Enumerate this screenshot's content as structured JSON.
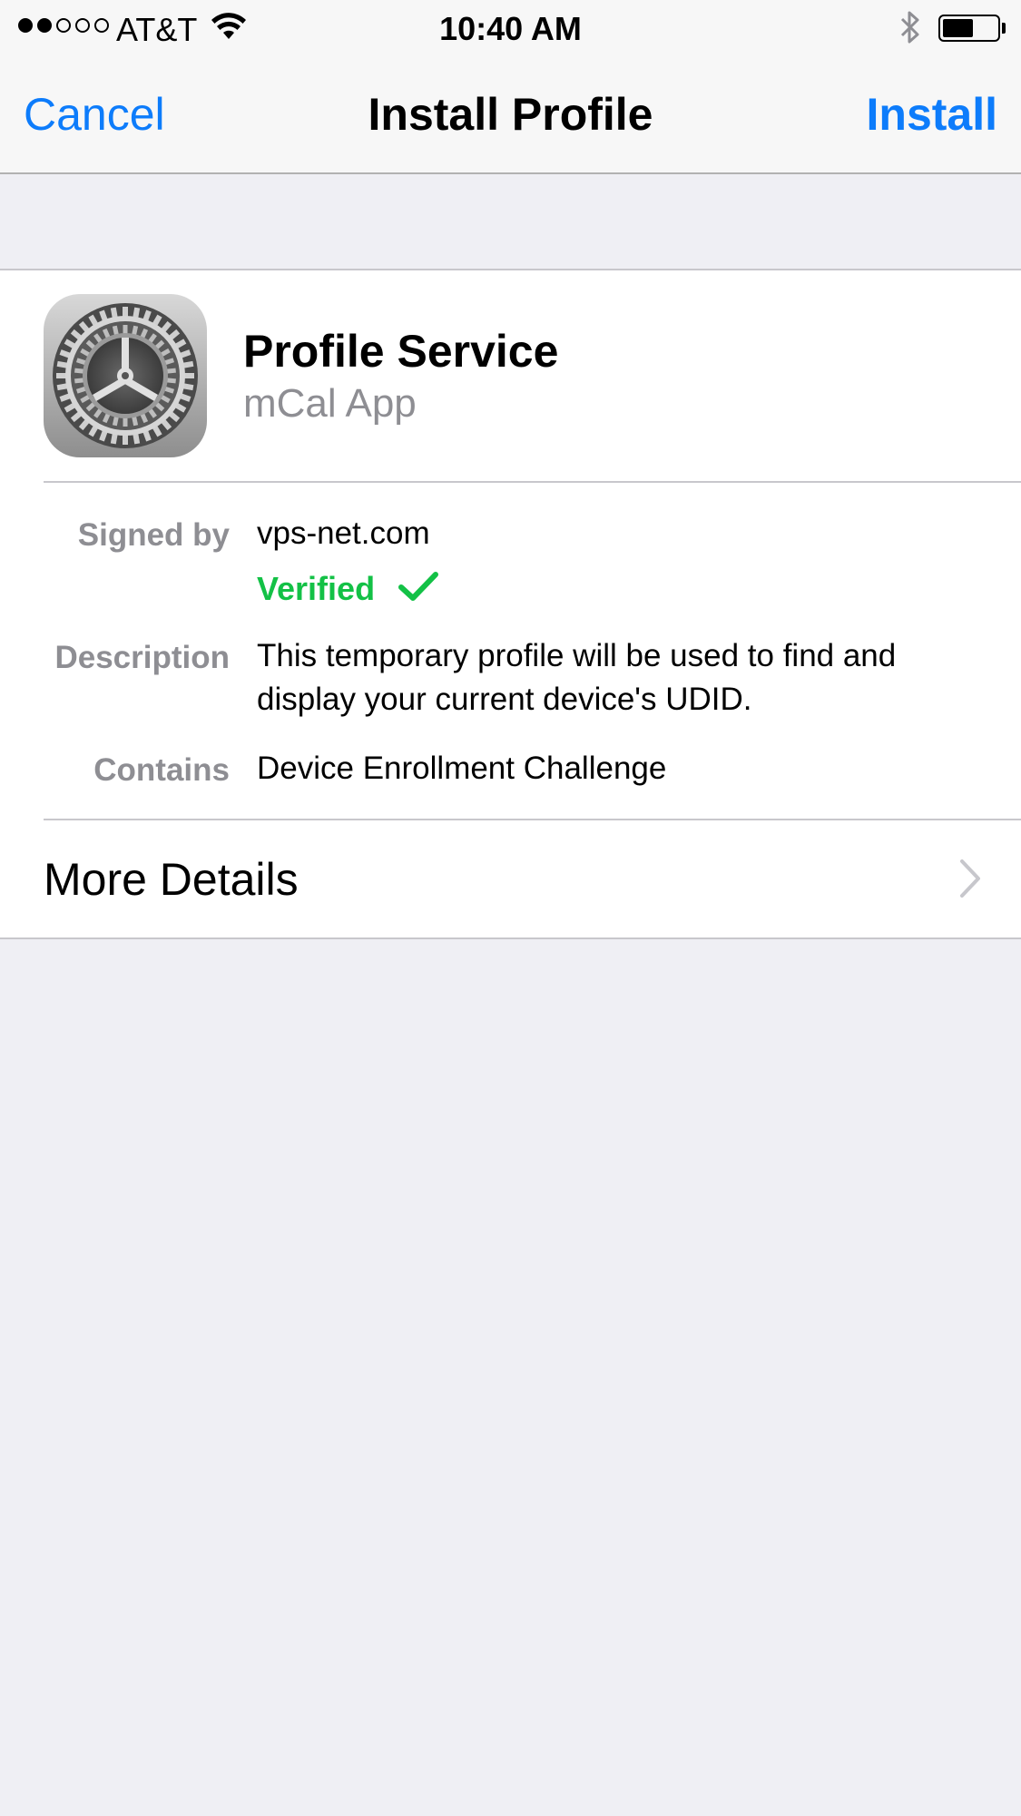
{
  "status_bar": {
    "carrier": "AT&T",
    "time": "10:40 AM",
    "signal_bars_filled": 2,
    "signal_bars_total": 5,
    "battery_level": 0.55,
    "icons": [
      "signal-dots",
      "wifi-icon",
      "bluetooth-icon",
      "battery-icon"
    ]
  },
  "navbar": {
    "cancel_label": "Cancel",
    "title": "Install Profile",
    "install_label": "Install"
  },
  "profile": {
    "name": "Profile Service",
    "organization": "mCal App",
    "icon": "settings-gear-icon"
  },
  "details": {
    "signed_by_label": "Signed by",
    "signed_by_value": "vps-net.com",
    "verified_label": "Verified",
    "description_label": "Description",
    "description_line1": "This temporary profile will be used to find and",
    "description_line2": "display your current device's UDID.",
    "contains_label": "Contains",
    "contains_value": "Device Enrollment Challenge"
  },
  "more_details": {
    "label": "More Details"
  },
  "colors": {
    "accent_blue": "#0d7cfb",
    "verified_green": "#13c146",
    "secondary_gray": "#8e8e93",
    "background": "#efeff4"
  }
}
